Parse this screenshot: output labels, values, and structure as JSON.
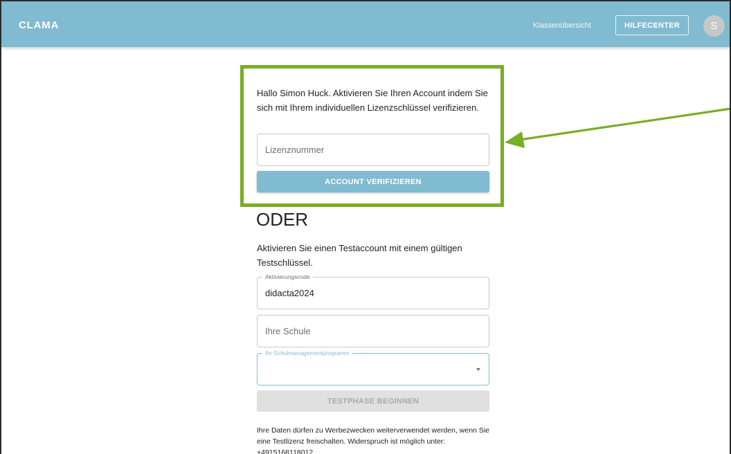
{
  "appbar": {
    "brand": "CLAMA",
    "nav_link": "Klassenübersicht",
    "help_button": "HILFECENTER",
    "avatar_initial": "S",
    "color": "#80bbd1"
  },
  "verify": {
    "intro": "Hallo Simon Huck. Aktivieren Sie Ihren Account indem Sie sich mit Ihrem individuellen Lizenzschlüssel verifizieren.",
    "license_placeholder": "Lizenznummer",
    "license_value": "",
    "button": "ACCOUNT VERIFIZIEREN"
  },
  "divider_heading": "ODER",
  "trial": {
    "intro": "Aktivieren Sie einen Testaccount mit einem gültigen Testschlüssel.",
    "activation_label": "Aktivierungscode",
    "activation_value": "didacta2024",
    "school_placeholder": "Ihre Schule",
    "school_value": "",
    "program_label": "Ihr Schulmanagementprogramm",
    "program_value": "",
    "button": "TESTPHASE BEGINNEN"
  },
  "footnote": "Ihre Daten dürfen zu Werbezwecken weiterverwendet werden, wenn Sie eine Testlizenz freischalten. Widerspruch ist möglich unter: +4915168118012",
  "annotation": {
    "highlight_color": "#79ad25",
    "arrow_color": "#79ad25"
  }
}
